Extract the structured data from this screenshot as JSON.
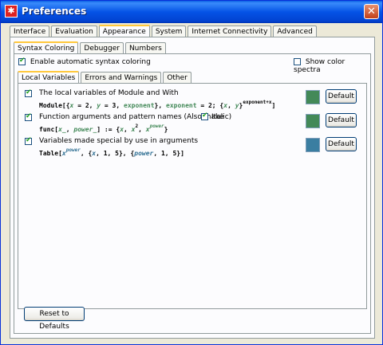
{
  "window": {
    "title": "Preferences",
    "close_glyph": "✕"
  },
  "main_tabs": [
    "Interface",
    "Evaluation",
    "Appearance",
    "System",
    "Internet Connectivity",
    "Advanced"
  ],
  "sub_tabs": [
    "Syntax Coloring",
    "Debugger",
    "Numbers"
  ],
  "syntax": {
    "enable_label": "Enable automatic syntax coloring",
    "enable_checked": true,
    "spectra_label": "Show color spectra",
    "spectra_checked": false
  },
  "inner_tabs": [
    "Local Variables",
    "Errors and Warnings",
    "Other"
  ],
  "items": [
    {
      "label": "The local variables of Module and With",
      "checked": true,
      "color": "#438958",
      "default_label": "Default"
    },
    {
      "label": "Function arguments and pattern names  (Also make",
      "italic_label": "Italic)",
      "checked": true,
      "italic_checked": true,
      "color": "#438958",
      "default_label": "Default"
    },
    {
      "label": "Variables made special by use in arguments",
      "checked": true,
      "color": "#3B7EA1",
      "default_label": "Default"
    }
  ],
  "code": {
    "l1": {
      "head": "Module",
      "open": "[{",
      "x": "x",
      "eq2": " = 2, ",
      "y": "y",
      "eq3": " = 3, ",
      "exp": "exponent",
      "close1": "}, ",
      "exp2": "exponent",
      "eq4": " = 2; {",
      "x2": "x",
      "comma": ", ",
      "y2": "y",
      "close2": "}",
      "sup": "exponent+x",
      "end": "]"
    },
    "l2": {
      "head": "func",
      "open": "[",
      "x": "x_",
      "comma": ", ",
      "power": "power_",
      "assign": "] := {",
      "x1": "x",
      "c1": ", ",
      "x2": "x",
      "sup2": "2",
      "c2": ", ",
      "x3": "x",
      "sup3": "power",
      "end": "}"
    },
    "l3": {
      "head": "Table",
      "open": "[",
      "x": "x",
      "sup": "power",
      "mid": ", {",
      "x2": "x",
      "r1": ", 1, 5}, {",
      "power": "power",
      "r2": ", 1, 5}]"
    }
  },
  "reset_label": "Reset to Defaults"
}
